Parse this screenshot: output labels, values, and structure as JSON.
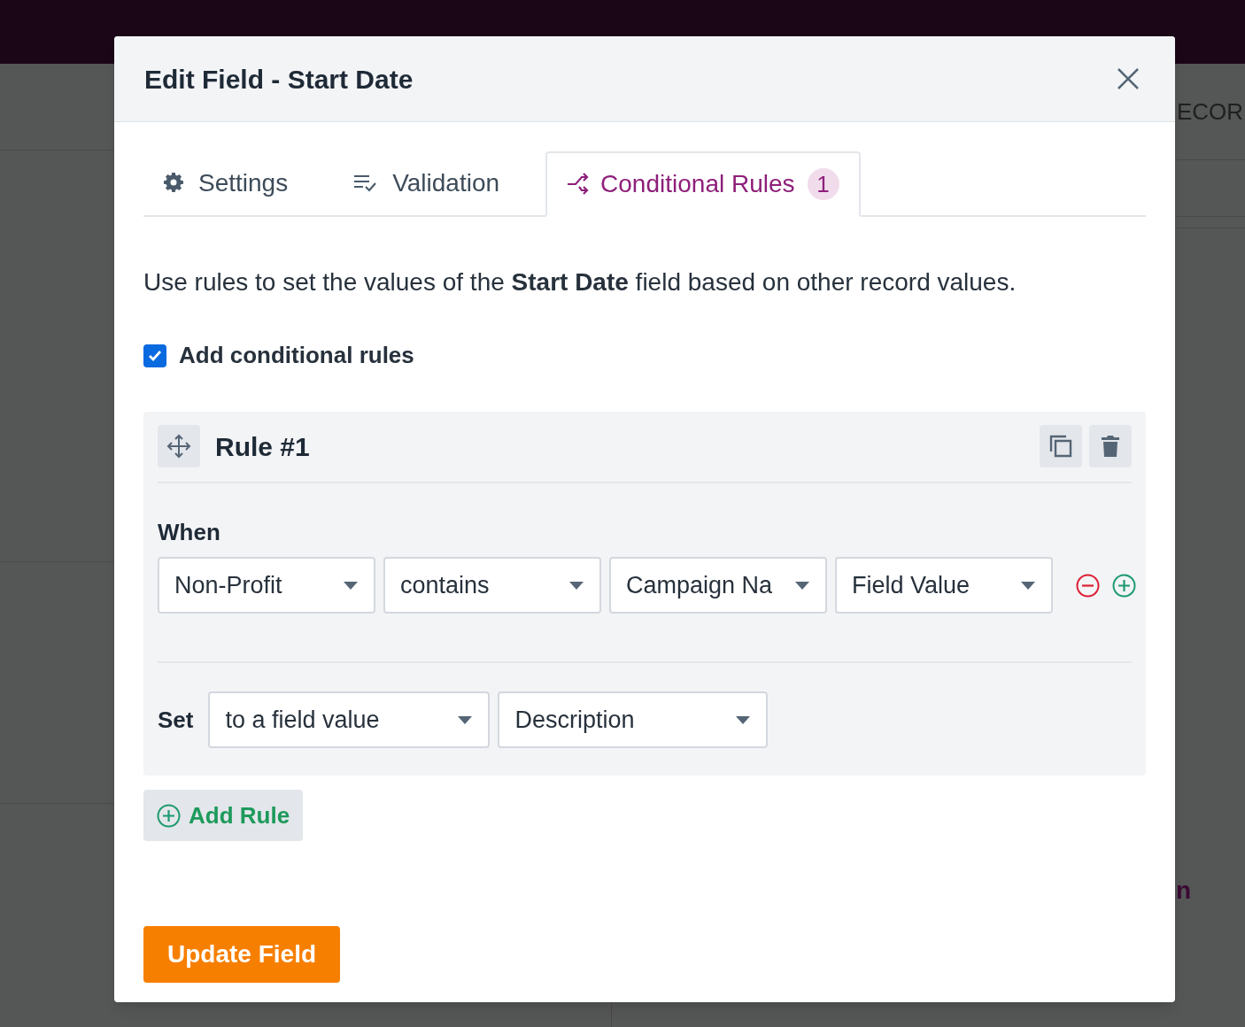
{
  "background": {
    "header_text": "ECOR",
    "fragment_text": "n"
  },
  "dialog": {
    "title": "Edit Field - Start Date"
  },
  "tabs": [
    {
      "kind": "settings",
      "label": "Settings",
      "selected": false
    },
    {
      "kind": "validation",
      "label": "Validation",
      "selected": false
    },
    {
      "kind": "rules",
      "label": "Conditional Rules",
      "badge": "1",
      "selected": true
    }
  ],
  "description": "Use rules to set the values of the **Start Date** field based on other record values.",
  "enable_rules": {
    "label": "Add conditional rules",
    "checked": true
  },
  "rules": [
    {
      "title": "Rule #1",
      "when_label": "When",
      "conditions": [
        {
          "fields": [
            "Non-Profit",
            "contains",
            "Campaign Na",
            "Field Value"
          ]
        }
      ],
      "set_label": "Set",
      "set_fields": [
        "to a field value",
        "Description"
      ]
    }
  ],
  "add_rule_button": "Add Rule",
  "submit_button": "Update Field"
}
